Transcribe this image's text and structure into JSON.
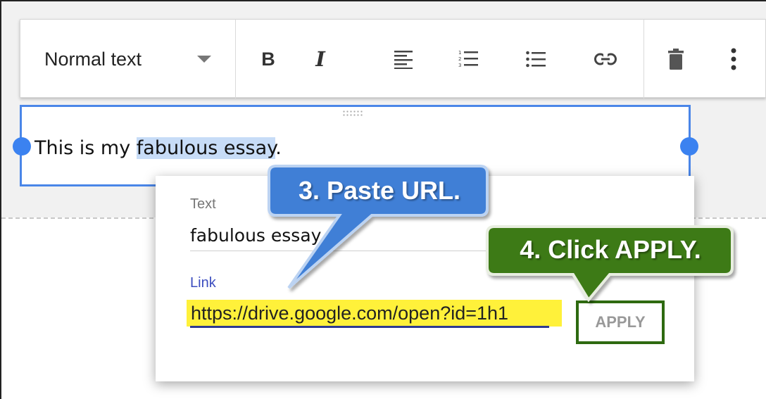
{
  "toolbar": {
    "style_select": "Normal text",
    "buttons": {
      "bold": "B",
      "italic": "I",
      "align_left": "align-left-icon",
      "numbered_list": "numbered-list-icon",
      "bulleted_list": "bulleted-list-icon",
      "link": "link-icon",
      "delete": "trash-icon",
      "more": "more-vert-icon"
    }
  },
  "document": {
    "text_before": "This is my ",
    "text_selected": "fabulous essay",
    "text_after": "."
  },
  "link_popup": {
    "text_label": "Text",
    "text_value": "fabulous essay",
    "link_label": "Link",
    "link_value": "https://drive.google.com/open?id=1h1",
    "apply_label": "APPLY"
  },
  "callouts": {
    "step3": "3. Paste URL.",
    "step4": "4. Click APPLY."
  },
  "colors": {
    "selection_blue": "#4a86e8",
    "callout3_fill": "#3f7fd6",
    "callout4_fill": "#3d7a17",
    "link_highlight": "#fff13a",
    "apply_border": "#2e6a10"
  }
}
